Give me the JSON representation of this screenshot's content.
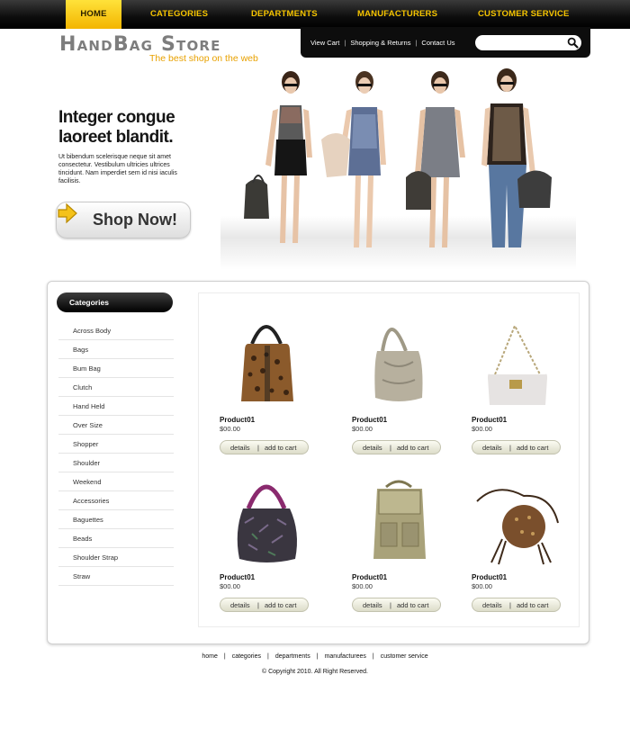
{
  "nav": {
    "items": [
      "Home",
      "Categories",
      "Departments",
      "Manufacturers",
      "Customer Service"
    ],
    "active": "Home"
  },
  "logo": {
    "title": "HandBag Store",
    "tagline": "The best shop on the web"
  },
  "utility": {
    "links": [
      "View Cart",
      "Shopping & Returns",
      "Contact Us"
    ],
    "search_placeholder": ""
  },
  "hero": {
    "title": "Integer congue laoreet blandit.",
    "text": "Ut bibendum scelerisque neque sit amet consectetur. Vestibulum ultricies ultrices tincidunt. Nam imperdiet sem id nisi iaculis facilisis.",
    "button": "Shop Now!"
  },
  "sidebar": {
    "heading": "Categories",
    "items": [
      "Across Body",
      "Bags",
      "Bum Bag",
      "Clutch",
      "Hand Held",
      "Over Size",
      "Shopper",
      "Shoulder",
      "Weekend",
      "Accessories",
      "Baguettes",
      "Beads",
      "Shoulder Strap",
      "Straw"
    ]
  },
  "products": [
    {
      "name": "Product01",
      "price": "$00.00",
      "details": "details",
      "cart": "add to cart"
    },
    {
      "name": "Product01",
      "price": "$00.00",
      "details": "details",
      "cart": "add to cart"
    },
    {
      "name": "Product01",
      "price": "$00.00",
      "details": "details",
      "cart": "add to cart"
    },
    {
      "name": "Product01",
      "price": "$00.00",
      "details": "details",
      "cart": "add to cart"
    },
    {
      "name": "Product01",
      "price": "$00.00",
      "details": "details",
      "cart": "add to cart"
    },
    {
      "name": "Product01",
      "price": "$00.00",
      "details": "details",
      "cart": "add to cart"
    }
  ],
  "footer": {
    "links": [
      "home",
      "categories",
      "departments",
      "manufacturees",
      "customer service"
    ],
    "copyright": "© Copyright 2010. All Right Reserved."
  },
  "colors": {
    "accent": "#f3b500",
    "nav_bg": "#0c0c0c",
    "tagline": "#e8a100"
  },
  "icons": {
    "search": "search-icon",
    "arrow": "arrow-right-icon"
  }
}
